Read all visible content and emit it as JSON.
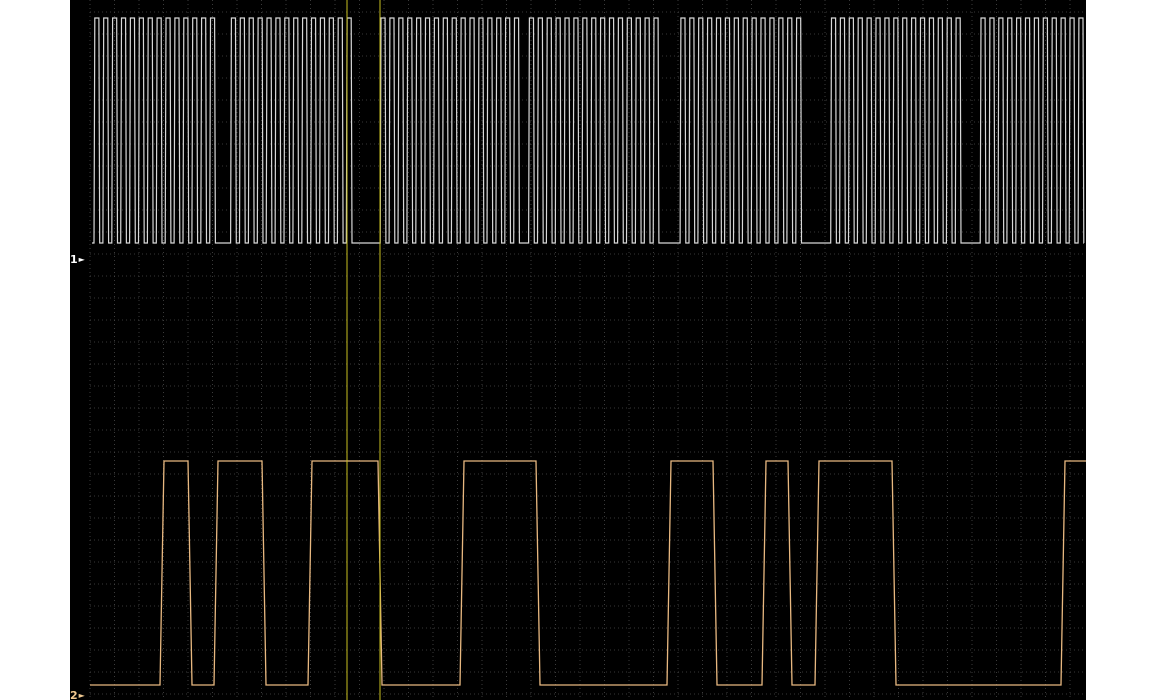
{
  "channels": [
    {
      "label": "1",
      "marker_icon": "right-arrow-icon",
      "color": "#d8d8d8"
    },
    {
      "label": "2",
      "marker_icon": "right-arrow-icon",
      "color": "#e8b880"
    }
  ],
  "colors": {
    "background": "#000000",
    "grid": "#4a4a4a",
    "cursor": "#c8c020"
  }
}
